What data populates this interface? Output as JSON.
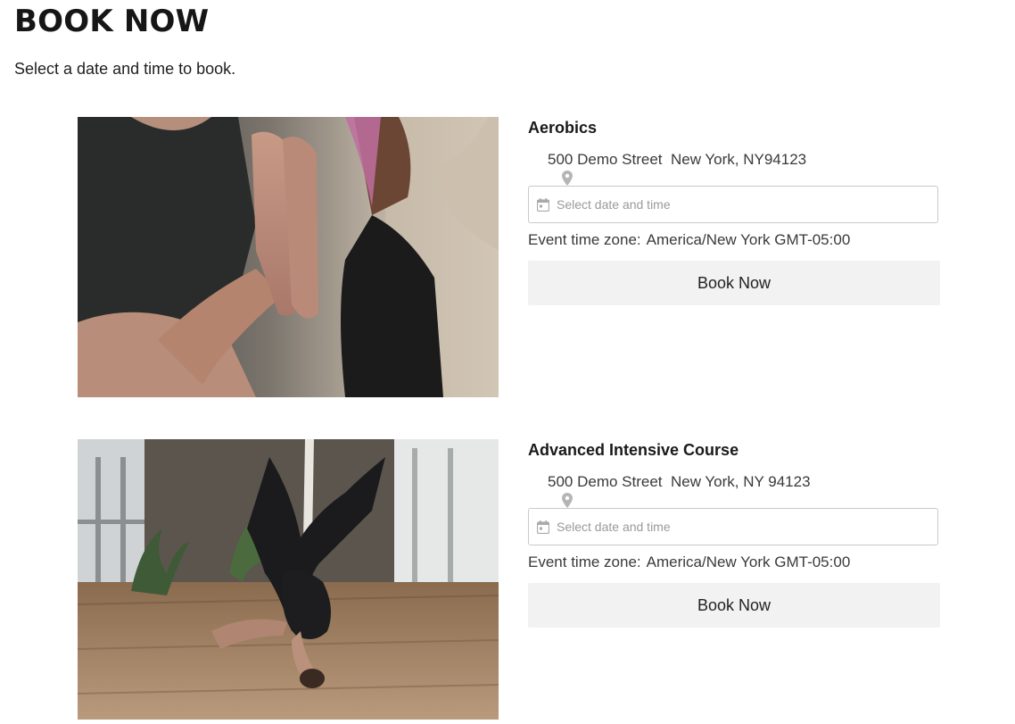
{
  "header": {
    "title": "BOOK NOW",
    "subtitle": "Select a date and time to book."
  },
  "events": [
    {
      "title": "Aerobics",
      "address": "500 Demo Street  New York, NY94123",
      "date_placeholder": "Select date and time",
      "timezone_label": "Event time zone:",
      "timezone_value": "America/New York GMT-05:00",
      "book_label": "Book Now"
    },
    {
      "title": "Advanced Intensive Course",
      "address": "500 Demo Street  New York, NY 94123",
      "date_placeholder": "Select date and time",
      "timezone_label": "Event time zone:",
      "timezone_value": "America/New York GMT-05:00",
      "book_label": "Book Now"
    }
  ],
  "icons": {
    "location": "map-pin-icon",
    "date": "calendar-icon"
  },
  "colors": {
    "button_bg": "#f2f2f2",
    "field_border": "#c9c9c9",
    "pin": "#b5b5b5"
  }
}
